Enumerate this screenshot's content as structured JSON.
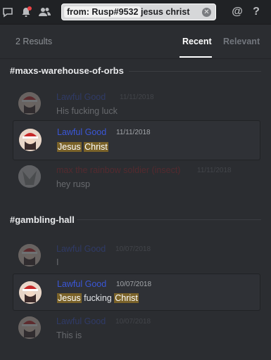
{
  "search": {
    "filter_chip": "from: Rusp#9532",
    "query": "jesus christ",
    "clear_icon": "clear-icon"
  },
  "results": {
    "count": "2 Results",
    "tabs": [
      "Recent",
      "Relevant"
    ]
  },
  "channels": [
    {
      "name": "#maxs-warehouse-of-orbs",
      "messages": [
        {
          "author": "Lawful Good",
          "time": "11/11/2018",
          "text": "His fucking luck",
          "kind": "context"
        },
        {
          "author": "Lawful Good",
          "time": "11/11/2018",
          "parts": [
            "Jesus",
            " ",
            "Christ"
          ],
          "kind": "match"
        },
        {
          "author": "max the rainbow soldier (insect)",
          "time": "11/11/2018",
          "text": "hey rusp",
          "kind": "context"
        }
      ]
    },
    {
      "name": "#gambling-hall",
      "messages": [
        {
          "author": "Lawful Good",
          "time": "10/07/2018",
          "text": "I",
          "kind": "context"
        },
        {
          "author": "Lawful Good",
          "time": "10/07/2018",
          "parts": [
            "Jesus",
            " fucking ",
            "Christ"
          ],
          "kind": "match"
        },
        {
          "author": "Lawful Good",
          "time": "10/07/2018",
          "text": "This is",
          "kind": "context"
        }
      ]
    }
  ],
  "colors": {
    "author_blue": "#3a56d6",
    "author_red": "#a8242b",
    "highlight": "#7a6229"
  }
}
